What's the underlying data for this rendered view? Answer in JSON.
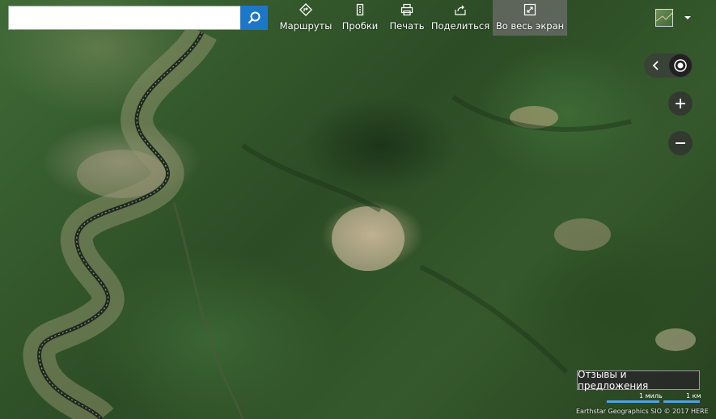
{
  "search": {
    "placeholder": "",
    "value": ""
  },
  "toolbar": {
    "routes": "Маршруты",
    "traffic": "Пробки",
    "print": "Печать",
    "share": "Поделиться",
    "fullscreen": "Во весь экран"
  },
  "feedback_label": "Отзывы и предложения",
  "scale": {
    "miles": "1 миль",
    "km": "1 км"
  },
  "copyright": "Earthstar Geographics SIO © 2017 HERE",
  "colors": {
    "accent": "#1d77c7",
    "scale_bar": "#4fa3e0"
  },
  "icons": [
    "search-icon",
    "routes-icon",
    "traffic-icon",
    "print-icon",
    "share-icon",
    "fullscreen-icon",
    "chevron-down-icon",
    "chevron-left-icon",
    "locate-icon",
    "zoom-in-icon",
    "zoom-out-icon"
  ]
}
